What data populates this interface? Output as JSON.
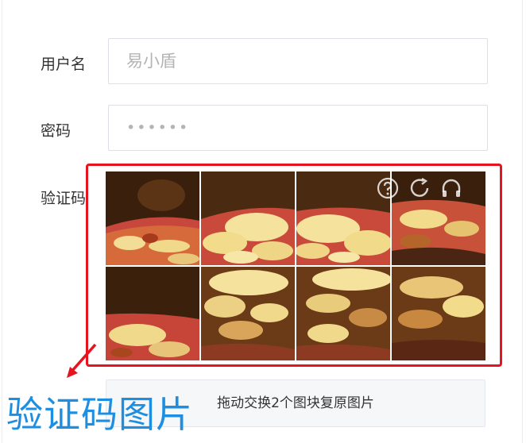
{
  "form": {
    "username_label": "用户名",
    "username_placeholder": "易小盾",
    "password_label": "密码",
    "password_value": "••••••",
    "captcha_label": "验证码"
  },
  "captcha": {
    "icons": [
      "help-icon",
      "refresh-icon",
      "audio-icon"
    ],
    "instruction": "拖动交换2个图块复原图片"
  },
  "annotation": {
    "text": "验证码图片",
    "color": "#1e8fe0",
    "highlight_color": "#e5141e"
  }
}
